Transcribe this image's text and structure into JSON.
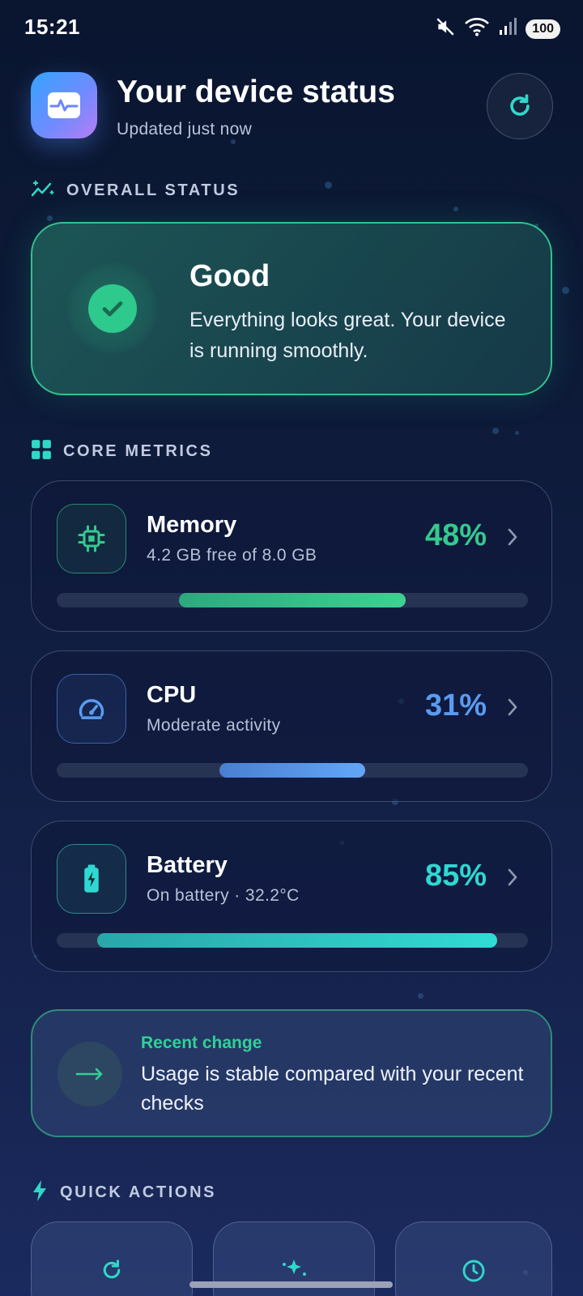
{
  "status_bar": {
    "time": "15:21",
    "battery": "100"
  },
  "header": {
    "title": "Your device status",
    "subtitle": "Updated just now"
  },
  "overall": {
    "section_label": "OVERALL STATUS",
    "status": "Good",
    "description": "Everything looks great. Your device is running smoothly."
  },
  "metrics": {
    "section_label": "CORE METRICS",
    "items": [
      {
        "name": "Memory",
        "detail": "4.2 GB free of 8.0 GB",
        "value": "48%",
        "percent": 48,
        "color": "#35c98e",
        "icon": "chip-icon"
      },
      {
        "name": "CPU",
        "detail": "Moderate activity",
        "value": "31%",
        "percent": 31,
        "color": "#5a9bf0",
        "icon": "gauge-icon"
      },
      {
        "name": "Battery",
        "detail": "On battery · 32.2°C",
        "value": "85%",
        "percent": 85,
        "color": "#2fd8d0",
        "icon": "battery-bolt-icon"
      }
    ]
  },
  "recent_change": {
    "title": "Recent change",
    "description": "Usage is stable compared with your recent checks"
  },
  "quick_actions": {
    "section_label": "QUICK ACTIONS",
    "icons": [
      "refresh-icon",
      "sparkles-icon",
      "clock-icon"
    ]
  },
  "colors": {
    "accent_green": "#2ec98d",
    "accent_blue": "#5a9bf0",
    "accent_teal": "#2fd8d0"
  }
}
